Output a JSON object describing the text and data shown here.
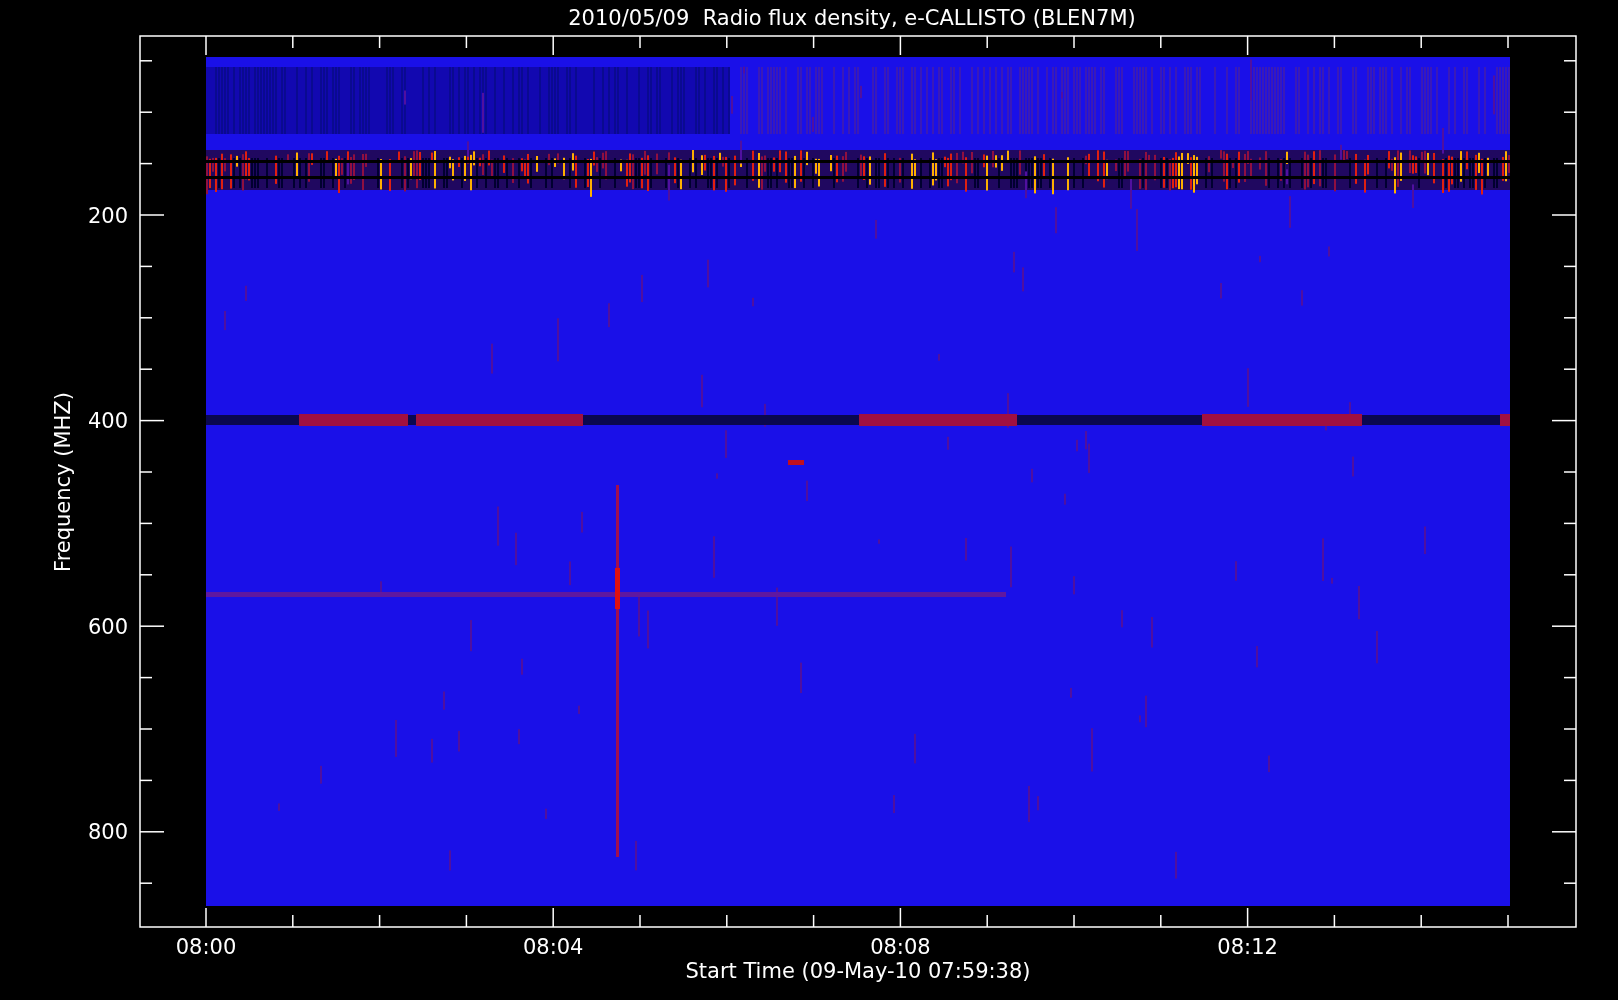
{
  "title": "2010/05/09  Radio flux density, e-CALLISTO (BLEN7M)",
  "y_axis": {
    "label": "Frequency (MHZ)",
    "ticks": [
      "200",
      "400",
      "600",
      "800"
    ]
  },
  "x_axis": {
    "label": "Start Time (09-May-10 07:59:38)",
    "ticks": [
      "08:00",
      "08:04",
      "08:08",
      "08:12"
    ]
  }
}
